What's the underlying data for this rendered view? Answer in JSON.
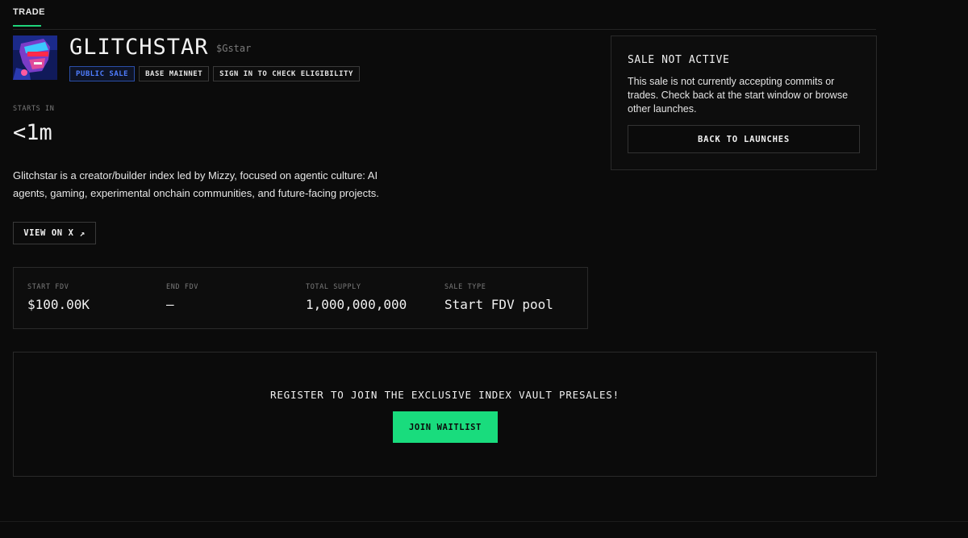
{
  "tabs": [
    {
      "label": "TRADE",
      "active": true
    }
  ],
  "token": {
    "name": "GLITCHSTAR",
    "ticker": "$Gstar",
    "avatar_icon": "glitchstar-avatar"
  },
  "badges": [
    "PUBLIC SALE",
    "BASE MAINNET",
    "SIGN IN TO CHECK ELIGIBILITY"
  ],
  "countdown": {
    "label": "STARTS IN",
    "value": "<1m"
  },
  "description": "Glitchstar is a creator/builder index led by Mizzy, focused on agentic culture: AI agents, gaming, experimental onchain communities, and future-facing projects.",
  "view_x": {
    "label": "VIEW ON X",
    "icon": "↗"
  },
  "stats": [
    {
      "label": "START FDV",
      "value": "$100.00K"
    },
    {
      "label": "END FDV",
      "value": "—"
    },
    {
      "label": "TOTAL SUPPLY",
      "value": "1,000,000,000"
    },
    {
      "label": "SALE TYPE",
      "value": "Start FDV pool"
    }
  ],
  "sale_card": {
    "title": "SALE NOT ACTIVE",
    "text": "This sale is not currently accepting commits or trades. Check back at the start window or browse other launches.",
    "button": "BACK TO LAUNCHES"
  },
  "waitlist": {
    "text": "REGISTER TO JOIN THE EXCLUSIVE INDEX VAULT PRESALES!",
    "button": "JOIN WAITLIST"
  },
  "colors": {
    "background": "#0b0b0b",
    "accent_green": "#19dc7d",
    "badge_blue": "#4f7dff",
    "border": "#2a2a2a"
  }
}
